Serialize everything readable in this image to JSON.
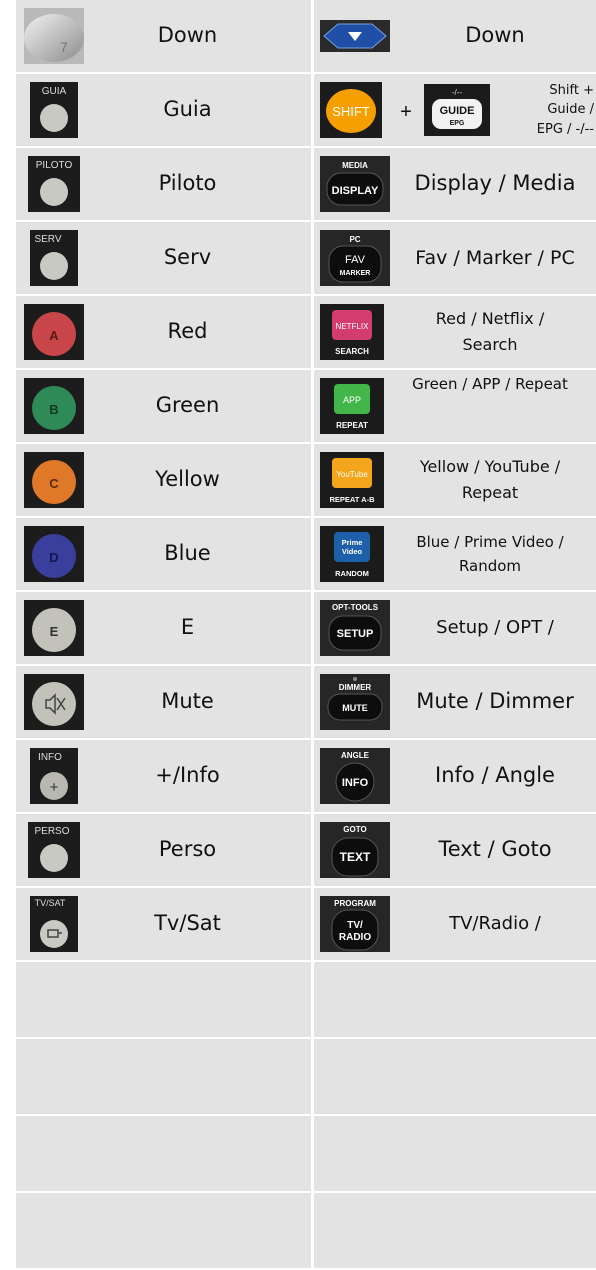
{
  "rows": [
    {
      "left": {
        "icon": "silver-7-button-icon",
        "label": "Down",
        "glyph": "7"
      },
      "right": {
        "icon": "blue-down-arrow-button-icon",
        "label": "Down"
      }
    },
    {
      "left": {
        "icon": "guia-button-icon",
        "label": "Guia",
        "caption": "GUIA"
      },
      "right": {
        "icon": "shift-guide-epg-buttons-icon",
        "label": "Shift + Guide / EPG / -/--",
        "label_lines": [
          "Shift +",
          "Guide /",
          "EPG / -/--"
        ],
        "shift_text": "SHIFT",
        "plus": "+",
        "guide_top": "-/--",
        "guide_text": "GUIDE",
        "guide_sub": "EPG"
      }
    },
    {
      "left": {
        "icon": "piloto-button-icon",
        "label": "Piloto",
        "caption": "PILOTO"
      },
      "right": {
        "icon": "display-media-button-icon",
        "label": "Display / Media",
        "caption": "MEDIA",
        "key_text": "DISPLAY"
      }
    },
    {
      "left": {
        "icon": "serv-button-icon",
        "label": "Serv",
        "caption": "SERV"
      },
      "right": {
        "icon": "fav-marker-pc-button-icon",
        "label": "Fav / Marker / PC",
        "caption": "PC",
        "key_text": "FAV",
        "key_sub": "MARKER"
      }
    },
    {
      "left": {
        "icon": "red-a-button-icon",
        "label": "Red",
        "glyph": "A"
      },
      "right": {
        "icon": "netflix-search-button-icon",
        "label_lines": [
          "Red / Netflix /",
          "Search"
        ],
        "key_text": "NETFLIX",
        "caption": "SEARCH"
      }
    },
    {
      "left": {
        "icon": "green-b-button-icon",
        "label": "Green",
        "glyph": "B"
      },
      "right": {
        "icon": "app-repeat-button-icon",
        "label_lines": [
          "Green / APP / Repeat"
        ],
        "key_text": "APP",
        "caption": "REPEAT"
      }
    },
    {
      "left": {
        "icon": "yellow-c-button-icon",
        "label": "Yellow",
        "glyph": "C"
      },
      "right": {
        "icon": "youtube-repeat-ab-button-icon",
        "label_lines": [
          "Yellow / YouTube /",
          "Repeat"
        ],
        "key_text": "YouTube",
        "caption": "REPEAT A-B"
      }
    },
    {
      "left": {
        "icon": "blue-d-button-icon",
        "label": "Blue",
        "glyph": "D"
      },
      "right": {
        "icon": "prime-video-random-button-icon",
        "label_lines": [
          "Blue / Prime Video /",
          "Random"
        ],
        "key_text": "Prime",
        "key_sub": "Video",
        "caption": "RANDOM"
      }
    },
    {
      "left": {
        "icon": "grey-e-button-icon",
        "label": "E",
        "glyph": "E"
      },
      "right": {
        "icon": "setup-opt-tools-button-icon",
        "label": "Setup / OPT /",
        "caption": "OPT-TOOLS",
        "key_text": "SETUP"
      }
    },
    {
      "left": {
        "icon": "mute-button-icon",
        "label": "Mute"
      },
      "right": {
        "icon": "mute-dimmer-button-icon",
        "label": "Mute / Dimmer",
        "caption": "DIMMER",
        "key_text": "MUTE"
      }
    },
    {
      "left": {
        "icon": "info-plus-button-icon",
        "label": "+/Info",
        "caption": "INFO",
        "glyph": "+"
      },
      "right": {
        "icon": "info-angle-button-icon",
        "label": "Info / Angle",
        "caption": "ANGLE",
        "key_text": "INFO"
      }
    },
    {
      "left": {
        "icon": "perso-button-icon",
        "label": "Perso",
        "caption": "PERSO"
      },
      "right": {
        "icon": "text-goto-button-icon",
        "label": "Text / Goto",
        "caption": "GOTO",
        "key_text": "TEXT"
      }
    },
    {
      "left": {
        "icon": "tv-sat-button-icon",
        "label": "Tv/Sat",
        "caption": "TV/SAT"
      },
      "right": {
        "icon": "tv-radio-program-button-icon",
        "label": "TV/Radio /",
        "caption": "PROGRAM",
        "key_text": "TV/",
        "key_sub": "RADIO"
      }
    }
  ],
  "colors": {
    "cell_bg": "#e3e3e3",
    "red": "#c8454a",
    "green": "#2e8a57",
    "yellow": "#e0782a",
    "blue": "#3a3f9e",
    "shift_orange": "#f5a000",
    "netflix_pink": "#d23c6e",
    "app_green": "#43b649",
    "youtube_amber": "#f3a61b",
    "prime_blue": "#1d5fa8",
    "arrow_blue": "#1f4fa6"
  }
}
